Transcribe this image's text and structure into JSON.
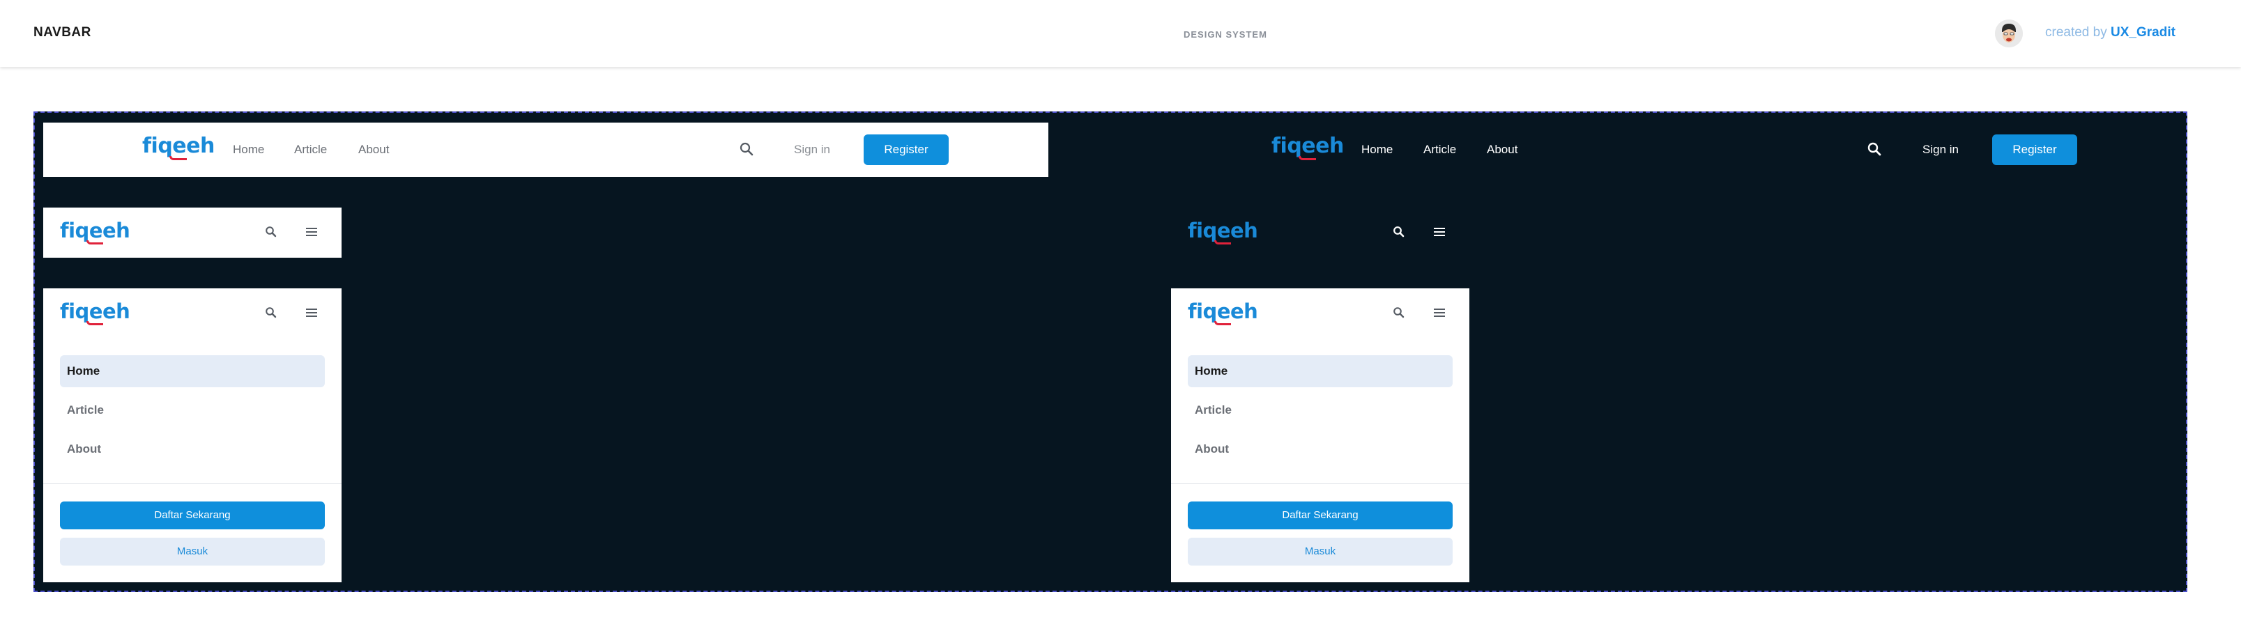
{
  "header": {
    "title": "NAVBAR",
    "subtitle": "DESIGN SYSTEM",
    "credit_prefix": "created by",
    "credit_name": "UX_Gradit"
  },
  "brand": {
    "logo_text": "fiqeeh",
    "primary": "#1a8ad8",
    "accent": "#e0223b",
    "dark_bg": "#061520"
  },
  "desktop_nav": {
    "links": [
      "Home",
      "Article",
      "About"
    ],
    "search_icon": "search-icon",
    "sign_in": "Sign in",
    "register": "Register"
  },
  "mobile_nav": {
    "search_icon": "search-icon",
    "menu_icon": "hamburger-menu-icon",
    "menu_items": [
      "Home",
      "Article",
      "About"
    ],
    "active_item": "Home",
    "primary_cta": "Daftar Sekarang",
    "secondary_cta": "Masuk"
  }
}
